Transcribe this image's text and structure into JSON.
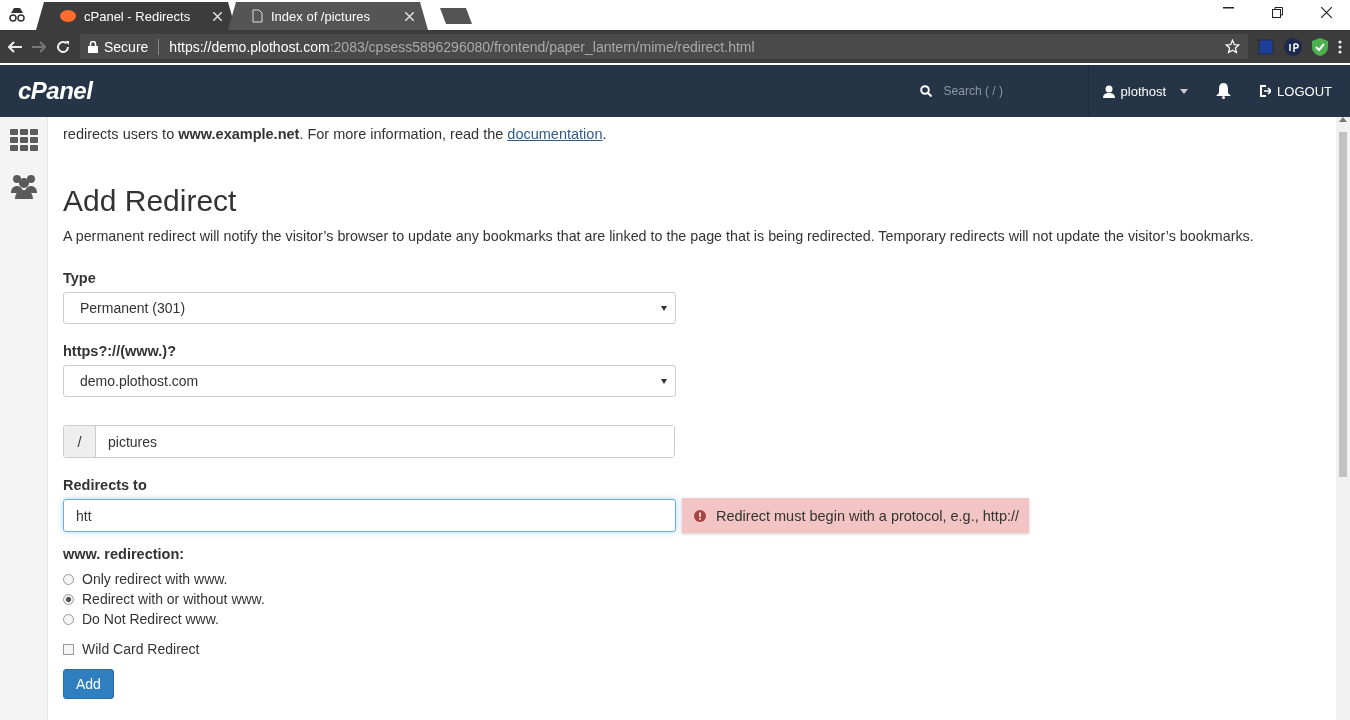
{
  "browser": {
    "tabs": [
      {
        "title": "cPanel - Redirects",
        "selected": true
      },
      {
        "title": "Index of /pictures",
        "selected": false
      }
    ],
    "secure_label": "Secure",
    "url_host": "https://demo.plothost.com",
    "url_path": ":2083/cpsess5896296080/frontend/paper_lantern/mime/redirect.html"
  },
  "header": {
    "logo": "cPanel",
    "search": {
      "placeholder": "Search ( / )"
    },
    "user": "plothost",
    "logout": "LOGOUT"
  },
  "intro": {
    "text": "redirects users to **www.example.net**. For more information, read the",
    "link": "documentation",
    "end": "."
  },
  "title": "Add Redirect",
  "description": "A permanent redirect will notify the visitor’s browser to update any bookmarks that are linked to the page that is being redirected. Temporary redirects will not update the visitor’s bookmarks.",
  "type": {
    "label": "Type",
    "value": "Permanent (301)"
  },
  "protocol": {
    "label": "https?://(www.)?",
    "value": "demo.plothost.com"
  },
  "path": {
    "prefix": "/",
    "value": "pictures"
  },
  "redirects_to": {
    "label": "Redirects to",
    "value": "htt",
    "error": "Redirect must begin with a protocol, e.g., http://"
  },
  "www_redirection": {
    "label": "www. redirection:",
    "options": [
      {
        "label": "Only redirect with www.",
        "selected": false
      },
      {
        "label": "Redirect with or without www.",
        "selected": true
      },
      {
        "label": "Do Not Redirect www.",
        "selected": false
      }
    ]
  },
  "wildcard": {
    "label": "Wild Card Redirect",
    "checked": false
  },
  "submit": "Add"
}
